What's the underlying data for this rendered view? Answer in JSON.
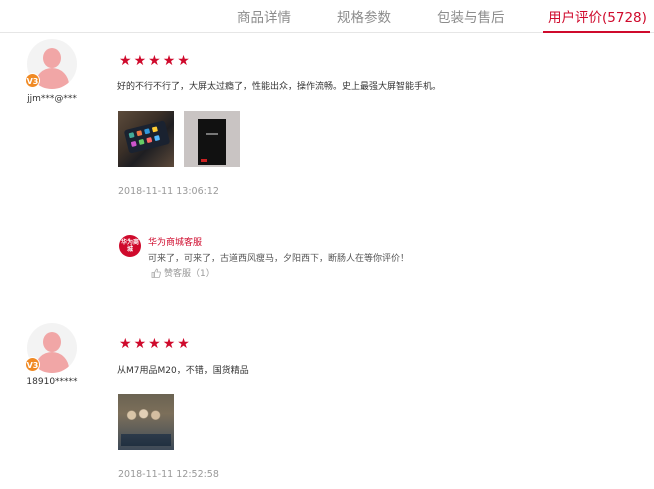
{
  "tabs": [
    {
      "label": "商品详情"
    },
    {
      "label": "规格参数"
    },
    {
      "label": "包装与售后"
    },
    {
      "label": "用户评价(5728)"
    }
  ],
  "reviews": [
    {
      "username": "jjm***@***",
      "vip_level": "V3",
      "rating": 5,
      "text": "好的不行不行了，大屏太过瘾了，性能出众，操作流畅。史上最强大屏智能手机。",
      "date": "2018-11-11 13:06:12",
      "reply": {
        "logo_text": "华为商城",
        "name": "华为商城客服",
        "text": "可来了，可来了，古道西风瘦马，夕阳西下，断肠人在等你评价！",
        "like_label": "赞客服（1）"
      }
    },
    {
      "username": "18910*****",
      "vip_level": "V3",
      "rating": 5,
      "text": "从M7用品M20，不错，国货精品",
      "date": "2018-11-11 12:52:58"
    }
  ],
  "colors": {
    "accent": "#cf0a2c",
    "vip": "#f08a24",
    "muted": "#999999"
  },
  "icons": {
    "star": "star-icon",
    "like": "thumbs-up-icon"
  }
}
